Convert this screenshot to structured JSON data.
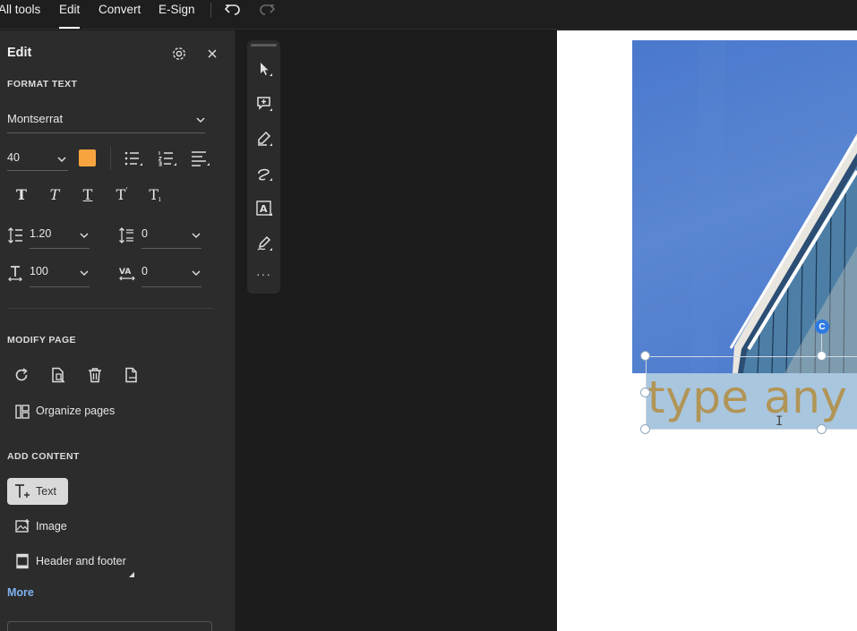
{
  "menubar": {
    "items": [
      {
        "label": "All tools",
        "active": false
      },
      {
        "label": "Edit",
        "active": true
      },
      {
        "label": "Convert",
        "active": false
      },
      {
        "label": "E-Sign",
        "active": false
      }
    ],
    "undo_icon": "undo-icon",
    "redo_icon": "redo-icon"
  },
  "edit_panel": {
    "title": "Edit",
    "settings_icon": "gear-icon",
    "close_icon": "close-icon",
    "format_text": {
      "heading": "FORMAT TEXT",
      "font_family": "Montserrat",
      "font_size": "40",
      "text_color": "#f7a440",
      "line_spacing": "1.20",
      "paragraph_spacing": "0",
      "horizontal_scale": "100",
      "character_spacing": "0",
      "style_icons": [
        "bold-icon",
        "italic-icon",
        "underline-icon",
        "superscript-icon",
        "subscript-icon"
      ],
      "list_icons": [
        "bulleted-list-icon",
        "numbered-list-icon",
        "align-icon"
      ]
    },
    "modify_page": {
      "heading": "MODIFY PAGE",
      "icons": [
        "rotate-icon",
        "extract-page-icon",
        "delete-icon",
        "insert-page-icon"
      ],
      "organize_label": "Organize pages"
    },
    "add_content": {
      "heading": "ADD CONTENT",
      "text_label": "Text",
      "image_label": "Image",
      "header_footer_label": "Header and footer",
      "more_label": "More"
    }
  },
  "toolbar": {
    "tools": [
      "select-icon",
      "add-comment-icon",
      "highlight-icon",
      "draw-icon",
      "text-recognition-icon",
      "sign-icon",
      "more-icon"
    ]
  },
  "document": {
    "typed_text": "type any",
    "photo_sky_color": "#4a78cc",
    "text_color": "#b19557",
    "selection_fill": "#a9c6df"
  }
}
